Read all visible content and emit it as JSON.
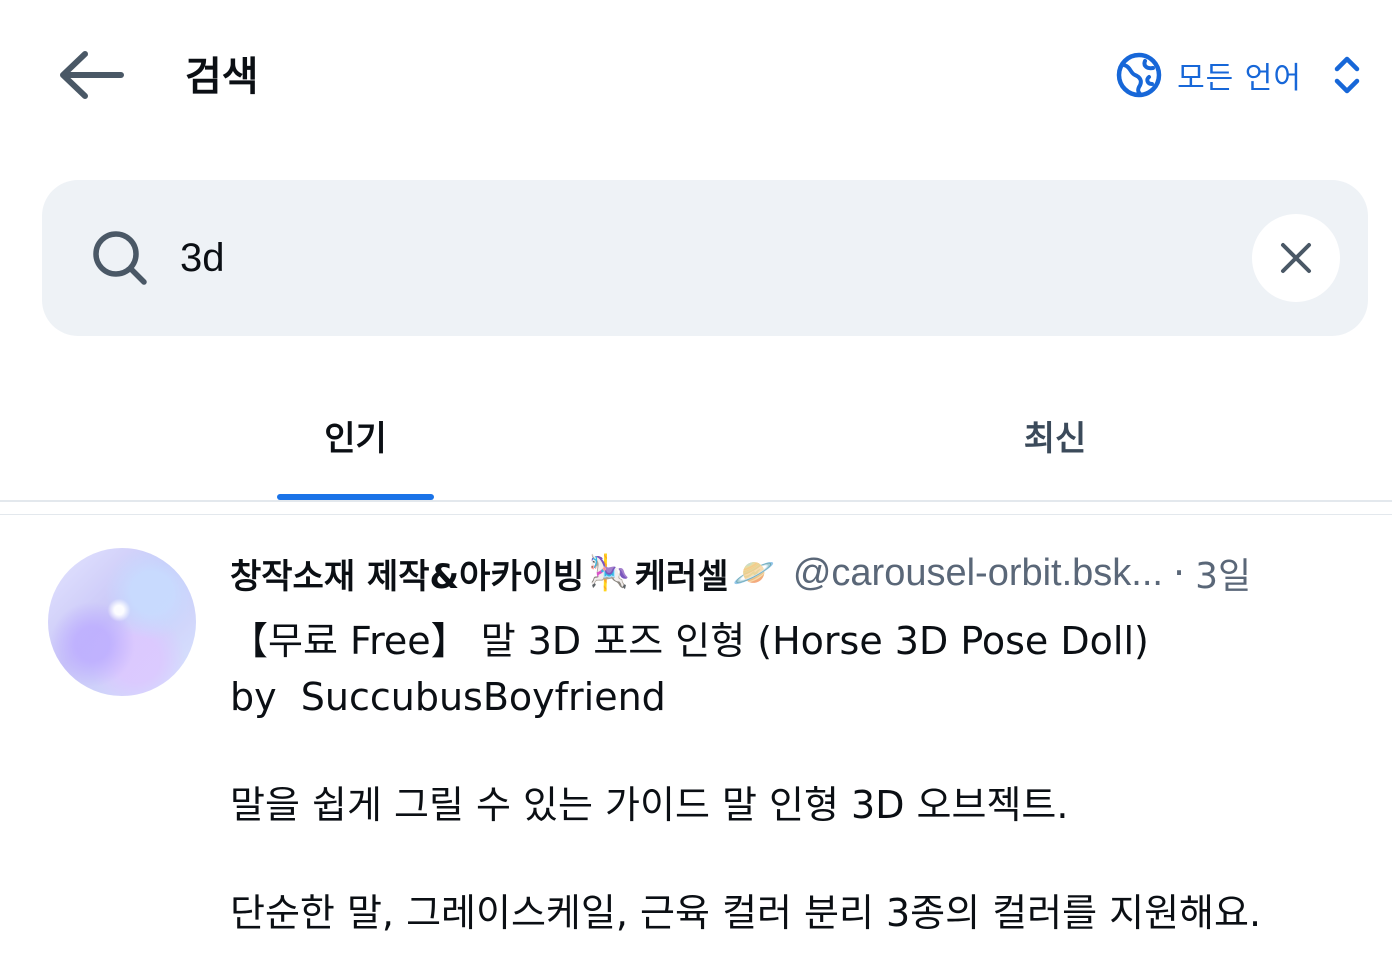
{
  "header": {
    "title": "검색",
    "language_label": "모든 언어",
    "icons": {
      "back": "arrow-left-icon",
      "language": "globe-icon",
      "language_toggle": "chevron-up-down-icon"
    }
  },
  "search": {
    "value": "3d",
    "icons": {
      "search": "search-icon",
      "clear": "close-icon"
    }
  },
  "tabs": [
    {
      "label": "인기",
      "active": true
    },
    {
      "label": "최신",
      "active": false
    }
  ],
  "post": {
    "display_name": "창작소재 제작&아카이빙",
    "display_name_suffix": "케러셀",
    "emoji_1": "🎠",
    "emoji_2": "🪐",
    "handle": "@carousel-orbit.bsk...",
    "separator": "·",
    "time": "3일",
    "text_line_1": "【무료 Free】 말 3D 포즈 인형 (Horse 3D Pose Doll)",
    "text_line_2": "by  SuccubusBoyfriend",
    "text_line_3": "말을 쉽게 그릴 수 있는 가이드 말 인형 3D 오브젝트.",
    "text_line_4": "단순한 말, 그레이스케일, 근육 컬러 분리 3종의 컬러를 지원해요."
  },
  "colors": {
    "accent": "#1a73e8",
    "search_bg": "#eef2f6",
    "muted_text": "#5a6778",
    "divider": "#e3e8ed"
  }
}
